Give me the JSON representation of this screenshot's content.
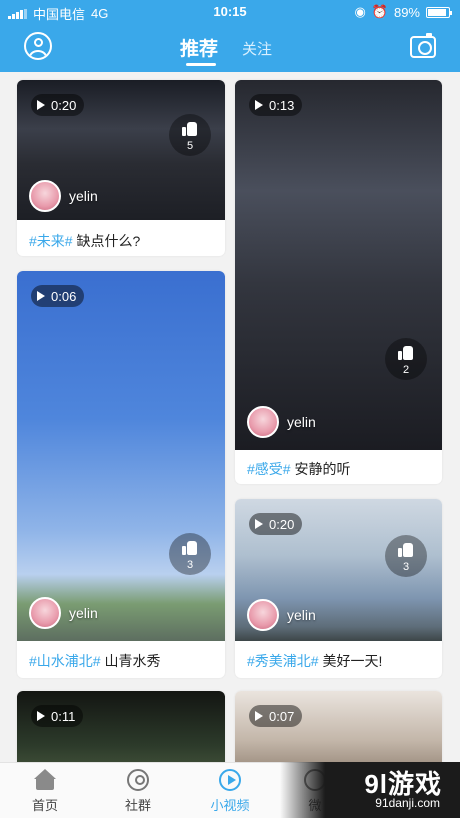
{
  "status": {
    "carrier": "中国电信",
    "network": "4G",
    "time": "10:15",
    "battery": "89%"
  },
  "header": {
    "tab_active": "推荐",
    "tab_other": "关注"
  },
  "cards": [
    {
      "duration": "0:20",
      "likes": "5",
      "username": "yelin",
      "caption_tag": "#未来#",
      "caption_text": " 缺点什么?"
    },
    {
      "duration": "0:13",
      "likes": "2",
      "username": "yelin",
      "caption_tag": "#感受#",
      "caption_text": " 安静的听"
    },
    {
      "duration": "0:06",
      "likes": "3",
      "username": "yelin",
      "caption_tag": "#山水浦北#",
      "caption_text": " 山青水秀"
    },
    {
      "duration": "0:20",
      "likes": "3",
      "username": "yelin",
      "caption_tag": "#秀美浦北#",
      "caption_text": " 美好一天!"
    },
    {
      "duration": "0:11"
    },
    {
      "duration": "0:07"
    }
  ],
  "tabbar": {
    "home": "首页",
    "community": "社群",
    "shortvideo": "小视频",
    "me_partial": "微"
  },
  "watermark": {
    "logo": "9l游戏",
    "url": "91danji.com"
  },
  "colors": {
    "accent": "#3aa8ea"
  }
}
